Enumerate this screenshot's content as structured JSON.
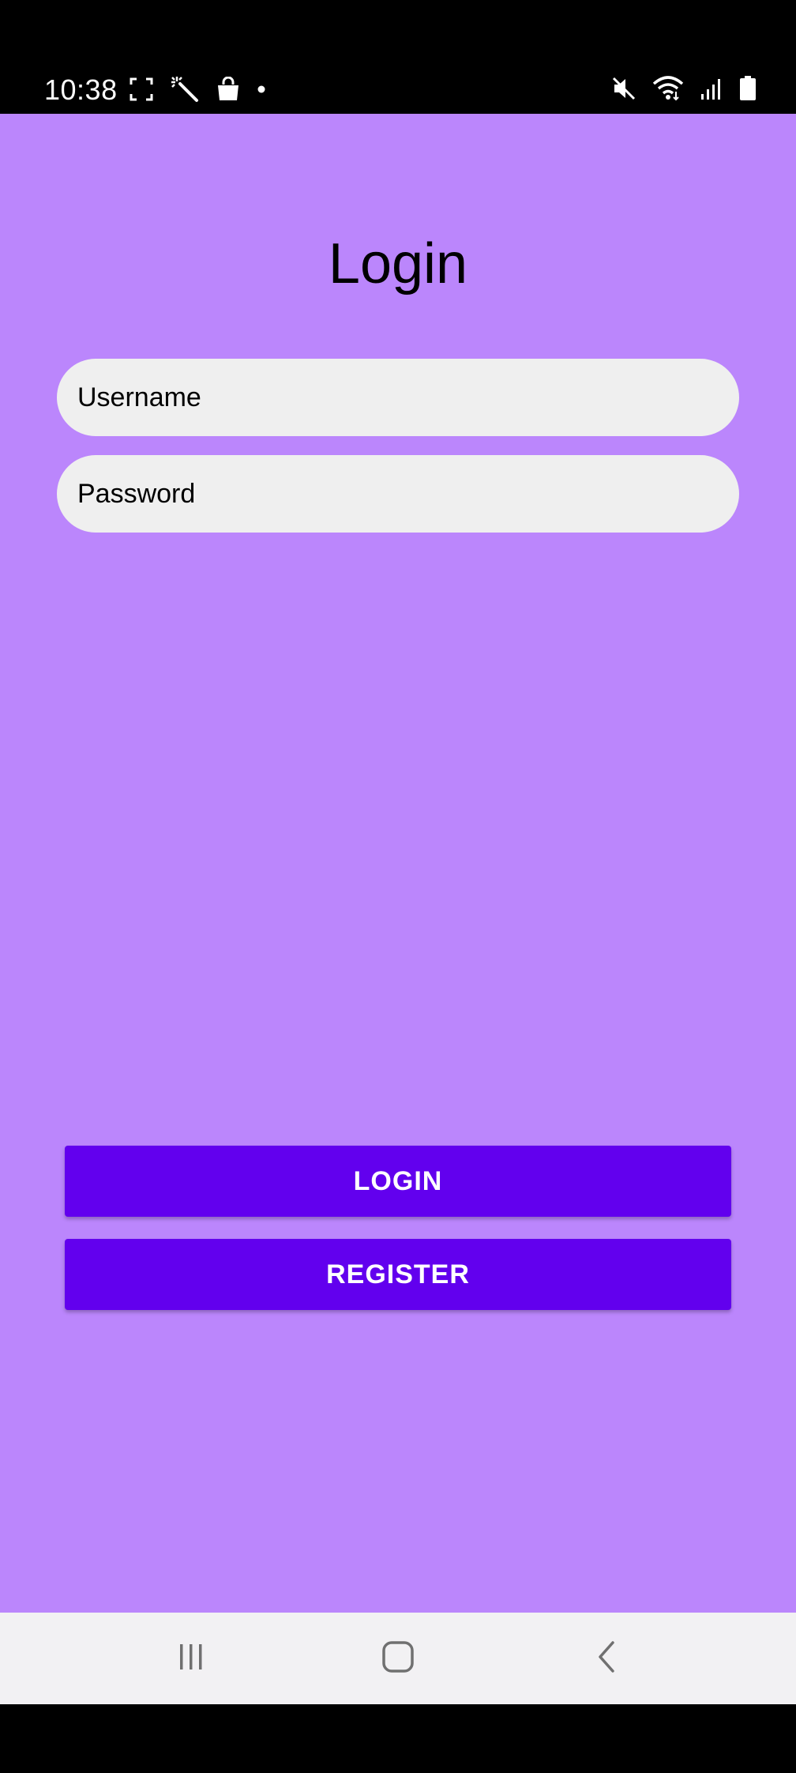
{
  "status_bar": {
    "time": "10:38",
    "left_icons": [
      "screenshot-frame-icon",
      "magic-wand-icon",
      "shopping-bag-icon",
      "notification-dot-icon"
    ],
    "right_icons": [
      "mute-icon",
      "wifi-icon",
      "signal-icon",
      "battery-icon"
    ]
  },
  "login": {
    "title": "Login",
    "username_placeholder": "Username",
    "password_placeholder": "Password",
    "login_label": "LOGIN",
    "register_label": "REGISTER"
  },
  "colors": {
    "background": "#bb86fc",
    "button": "#6200ee",
    "field": "#efefef",
    "nav_bar": "#f2f1f3"
  },
  "nav_bar": {
    "icons": [
      "recents-icon",
      "home-icon",
      "back-icon"
    ]
  }
}
